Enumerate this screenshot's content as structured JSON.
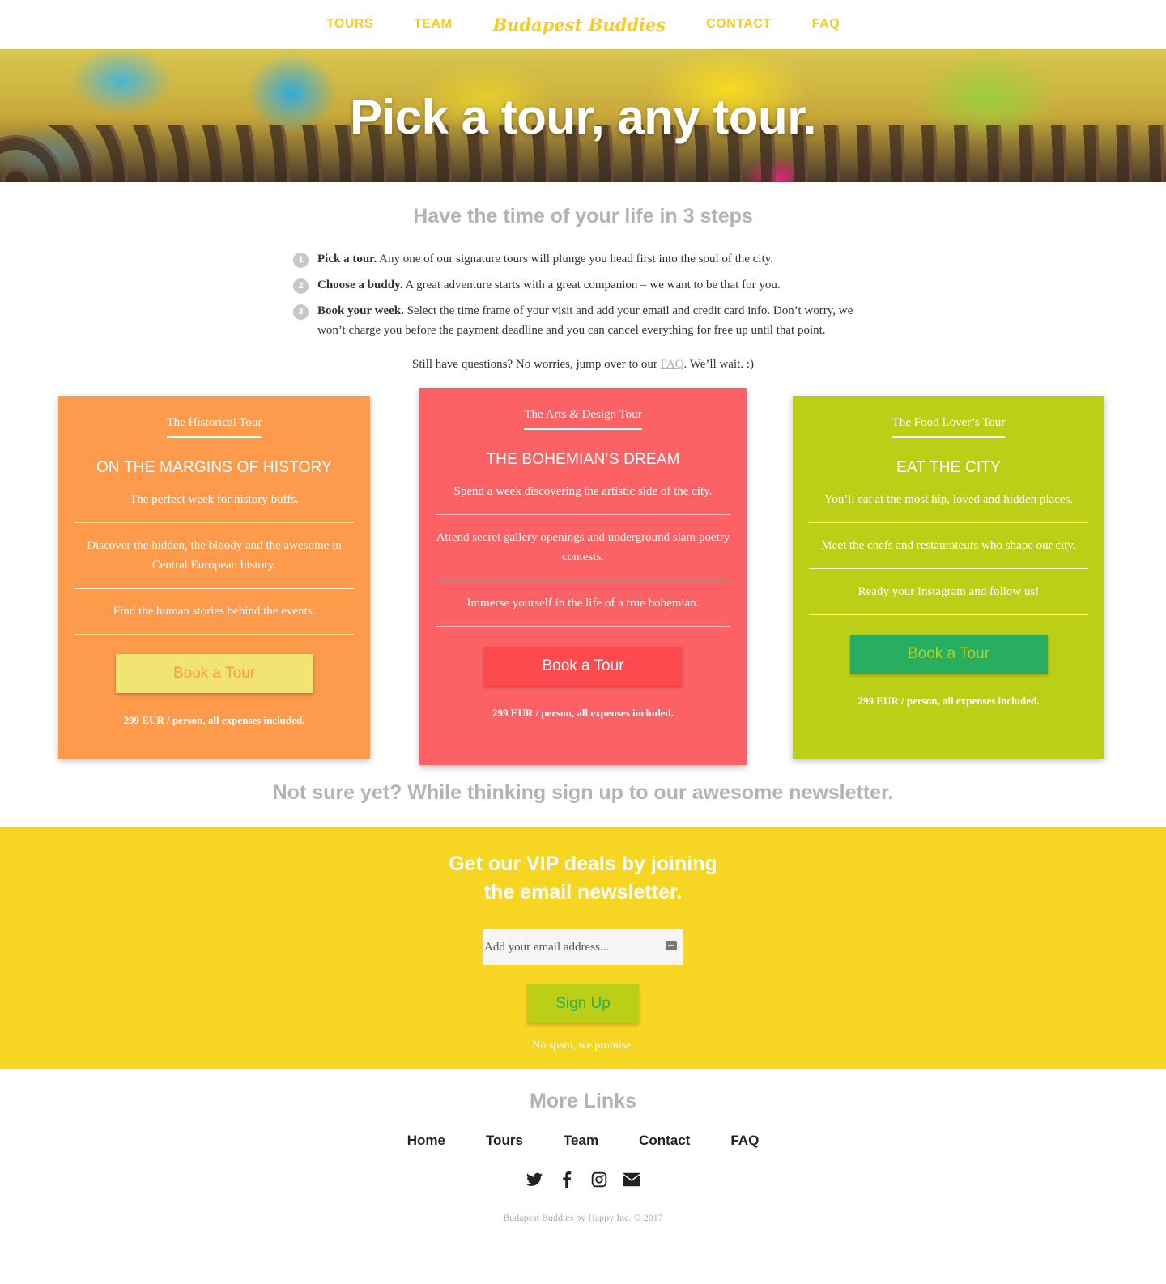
{
  "nav": {
    "left": [
      "TOURS",
      "TEAM"
    ],
    "brand": "Budapest Buddies",
    "right": [
      "CONTACT",
      "FAQ"
    ]
  },
  "hero": {
    "title": "Pick a tour, any tour."
  },
  "steps": {
    "title": "Have the time of your life in 3 steps",
    "items": [
      {
        "num": "1",
        "lead": "Pick a tour.",
        "text": " Any one of our signature tours will plunge you head first into the soul of the city."
      },
      {
        "num": "2",
        "lead": "Choose a buddy.",
        "text": " A great adventure starts with a great companion – we want to be that for you."
      },
      {
        "num": "3",
        "lead": "Book your week.",
        "text": " Select the time frame of your visit and add your email and credit card info. Don’t worry, we won’t charge you before the payment deadline and you can cancel everything for free up until that point."
      }
    ],
    "faq_prefix": "Still have questions? No worries, jump over to our ",
    "faq_link": "FAQ",
    "faq_suffix": ". We’ll wait. :)"
  },
  "cards": [
    {
      "small_title": "The Historical Tour",
      "big_title": "ON THE MARGINS OF HISTORY",
      "features": [
        "The perfect week for history buffs.",
        "Discover the hidden, the bloody and the awesome in Central European history.",
        "Find the human stories behind the events."
      ],
      "button": "Book a Tour",
      "price": "299 EUR / person, all expenses included."
    },
    {
      "small_title": "The Arts & Design Tour",
      "big_title": "THE BOHEMIAN’S DREAM",
      "features": [
        "Spend a week discovering the artistic side of the city.",
        "Attend secret gallery openings and underground slam poetry contests.",
        "Immerse yourself in the life of a true bohemian."
      ],
      "button": "Book a Tour",
      "price": "299 EUR / person, all expenses included."
    },
    {
      "small_title": "The Food Lover’s Tour",
      "big_title": "EAT THE CITY",
      "features": [
        "You’ll eat at the most hip, loved and hidden places.",
        "Meet the chefs and restaurateurs who shape our city.",
        "Ready your Instagram and follow us!"
      ],
      "button": "Book a Tour",
      "price": "299 EUR / person, all expenses included."
    }
  ],
  "newsletter": {
    "title": "Not sure yet? While thinking sign up to our awesome newsletter.",
    "heading_line1": "Get our VIP deals by joining",
    "heading_line2": "the email newsletter.",
    "email_placeholder": "Add your email address...",
    "button": "Sign Up",
    "note": "No spam, we promise."
  },
  "footer": {
    "title": "More Links",
    "links": [
      "Home",
      "Tours",
      "Team",
      "Contact",
      "FAQ"
    ],
    "socials": [
      "twitter-icon",
      "facebook-icon",
      "instagram-icon",
      "envelope-icon"
    ],
    "copyright": "Budapest Buddies by Happy Inc. © 2017"
  },
  "colors": {
    "brand_yellow": "#f5cc21",
    "orange": "#fd9a4c",
    "red": "#fc6265",
    "lime": "#bccf16",
    "green": "#27ae60",
    "signup_bg": "#f7d523",
    "muted_gray": "#b3b3b3"
  }
}
